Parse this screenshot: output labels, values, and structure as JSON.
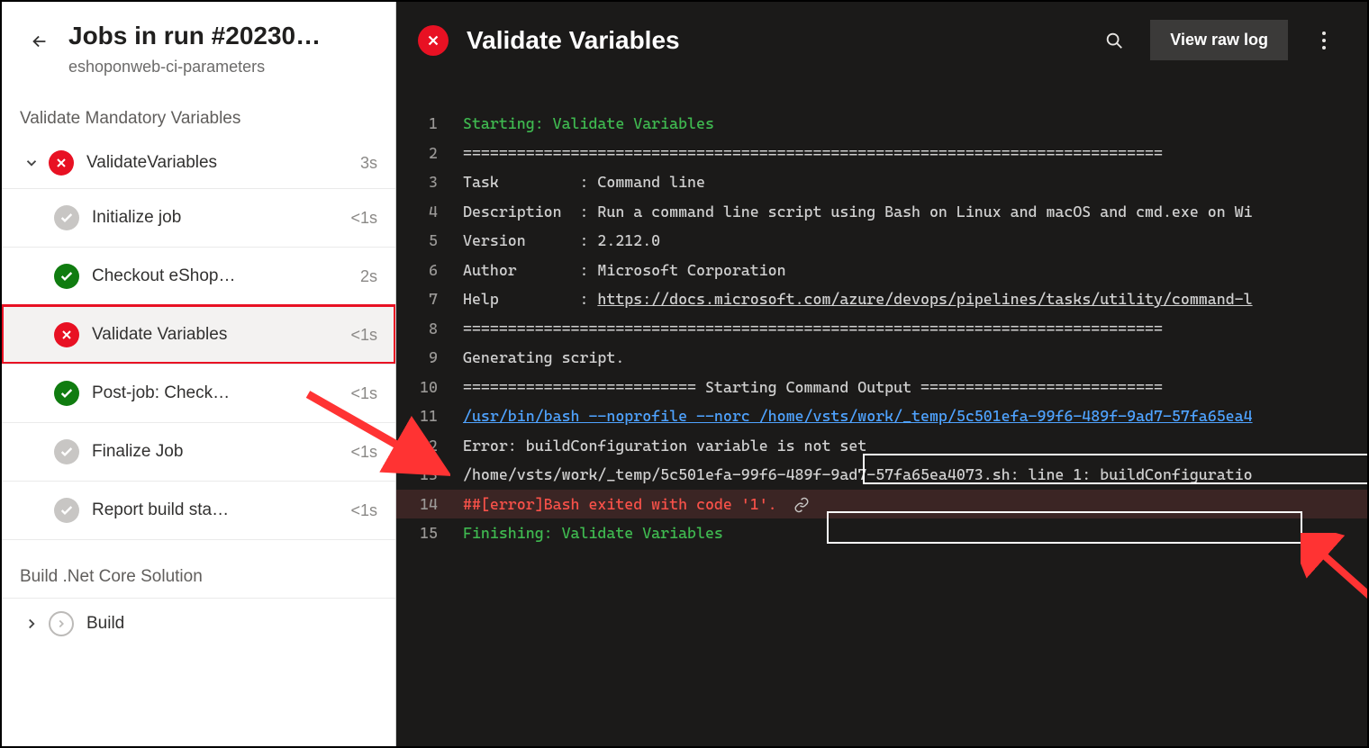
{
  "header": {
    "title": "Jobs in run #20230…",
    "subtitle": "eshoponweb-ci-parameters"
  },
  "stages": [
    {
      "label": "Validate Mandatory Variables"
    },
    {
      "label": "Build .Net Core Solution"
    }
  ],
  "job": {
    "name": "ValidateVariables",
    "duration": "3s"
  },
  "steps": [
    {
      "status": "skip",
      "name": "Initialize job",
      "duration": "<1s"
    },
    {
      "status": "pass",
      "name": "Checkout eShop…",
      "duration": "2s"
    },
    {
      "status": "fail",
      "name": "Validate Variables",
      "duration": "<1s",
      "selected": true
    },
    {
      "status": "pass",
      "name": "Post-job: Check…",
      "duration": "<1s"
    },
    {
      "status": "skip",
      "name": "Finalize Job",
      "duration": "<1s"
    },
    {
      "status": "skip",
      "name": "Report build sta…",
      "duration": "<1s"
    }
  ],
  "buildJob": {
    "name": "Build"
  },
  "logHeader": {
    "title": "Validate Variables",
    "rawButton": "View raw log"
  },
  "log": {
    "l1": "Starting: Validate Variables",
    "l2": "==============================================================================",
    "l3": "Task         : Command line",
    "l4": "Description  : Run a command line script using Bash on Linux and macOS and cmd.exe on Wi",
    "l5": "Version      : 2.212.0",
    "l6": "Author       : Microsoft Corporation",
    "l7a": "Help         : ",
    "l7b": "https://docs.microsoft.com/azure/devops/pipelines/tasks/utility/command-l",
    "l8": "==============================================================================",
    "l9": "Generating script.",
    "l10": "========================== Starting Command Output ===========================",
    "l11": "/usr/bin/bash --noprofile --norc /home/vsts/work/_temp/5c501efa-99f6-489f-9ad7-57fa65ea4",
    "l12": "Error: buildConfiguration variable is not set",
    "l13": "/home/vsts/work/_temp/5c501efa-99f6-489f-9ad7-57fa65ea4073.sh: line 1: buildConfiguratio",
    "l14": "##[error]Bash exited with code '1'.",
    "l15": "Finishing: Validate Variables"
  }
}
